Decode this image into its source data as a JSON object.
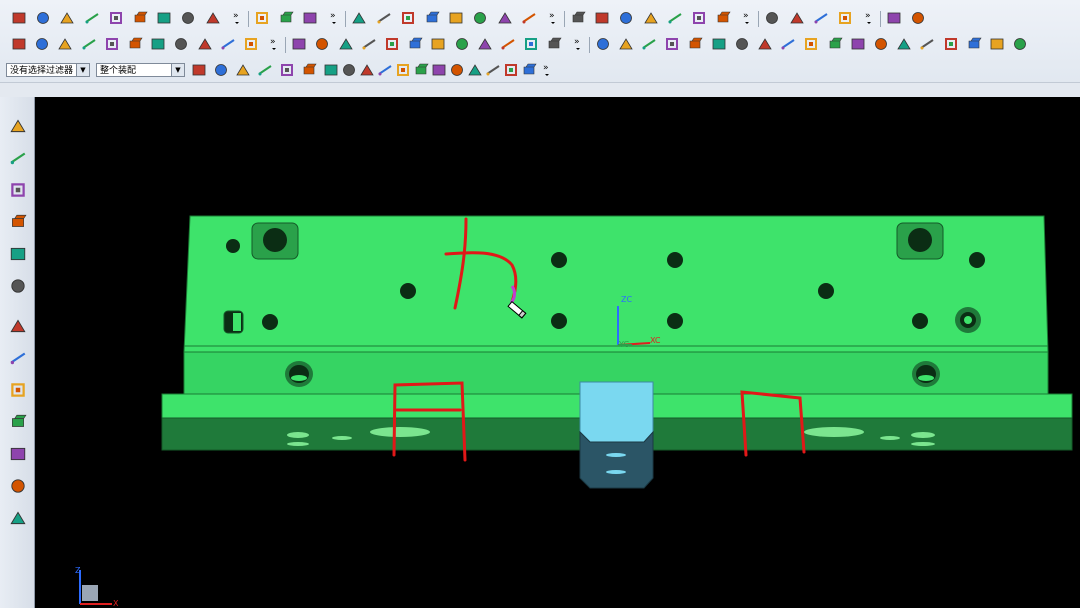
{
  "toolbar": {
    "row1_icons": [
      "line-icon",
      "arc-icon",
      "rectangle-icon",
      "spline-icon",
      "text-icon",
      "sketch-icon",
      "extrude-icon",
      "revolve-icon",
      "sweep-icon",
      "more-icon",
      "trim-icon",
      "bridge-icon",
      "fillet-curve-icon",
      "more-icon",
      "view-section-icon",
      "shaded-icon",
      "layer-icon",
      "move-icon",
      "analysis-icon",
      "blend-icon",
      "draft-icon",
      "material-icon",
      "more-icon",
      "rotate-icon",
      "face-icon",
      "edit-surface-icon",
      "mesh-icon",
      "swept-icon",
      "offset-icon",
      "pipe-icon",
      "more-icon",
      "mold-icon",
      "parting-icon",
      "core-cavity-icon",
      "slider-icon",
      "more-icon",
      "color-icon",
      "inspect-icon"
    ],
    "row2_icons": [
      "text-tool-icon",
      "pattern-icon",
      "box-icon",
      "cylinder-icon",
      "grid-icon",
      "table-icon",
      "solid-red-icon",
      "frame-icon",
      "window-icon",
      "assembly-icon",
      "bom-icon",
      "more-icon",
      "rotate-view-icon",
      "cancel-icon",
      "snap-icon",
      "palette-icon",
      "orange-cube-icon",
      "gold-shape-icon",
      "cone-icon",
      "curve-red-icon",
      "wire-cube-icon",
      "point-icon",
      "measure-icon",
      "gold-block-icon",
      "more-icon",
      "bracket-icon",
      "align-icon",
      "tee-icon",
      "t-icon",
      "corner-icon",
      "pin-icon",
      "square-orange-icon",
      "square-icon",
      "grid-box-icon",
      "round-corner-icon",
      "l-corner-icon",
      "angle-icon",
      "constraint-icon",
      "hatch-icon",
      "lattice-icon",
      "ladder-icon",
      "d-icon",
      "step-icon",
      "rail-icon"
    ],
    "row3": {
      "filter_select": "没有选择过滤器",
      "assembly_select": "整个装配",
      "icons": [
        "filter-icon",
        "selection-icon",
        "arrow-icon",
        "snap-icon",
        "rect-select-icon",
        "view-icon",
        "cube-icon",
        "snap-point-icon",
        "snap-grid-icon",
        "line-snap-icon",
        "tangent-icon",
        "arc-snap-icon",
        "perp-icon",
        "circle-snap-icon",
        "center-icon",
        "plus-icon",
        "slash-icon",
        "quadrant-icon",
        "more-icon"
      ]
    }
  },
  "left_toolbar": {
    "icons": [
      "wizard-icon",
      "assembly-navigator-icon",
      "part-navigator-icon",
      "reuse-library-icon",
      "history-icon",
      "web-icon",
      "clock-icon",
      "roles-icon",
      "palette-icon",
      "measure-icon",
      "system-icon",
      "doc-icon",
      "text-icon"
    ]
  },
  "viewport": {
    "background": "#000000",
    "model_color": "#3ee36b",
    "model_dark": "#22a545",
    "boss_color": "#7ad8f0",
    "annotation_color": "#e11818",
    "wcs": {
      "z_label": "ZC",
      "x_label": "XC",
      "y_label": "YC"
    },
    "triad": {
      "z_label": "Z",
      "x_label": "X"
    }
  }
}
